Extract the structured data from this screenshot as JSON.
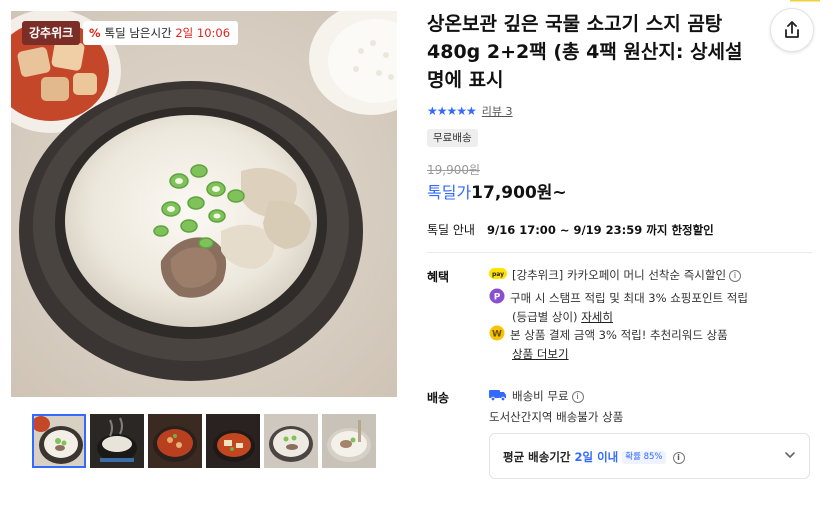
{
  "badges": {
    "brand": "강추위크",
    "deal_icon": "%",
    "deal_label": "톡딜 남은시간",
    "deal_time": "2일 10:06"
  },
  "product": {
    "title": "상온보관 깊은 국물 소고기 스지 곰탕 480g 2+2팩 (총 4팩 원산지: 상세설명에 표시",
    "stars": "★★★★★",
    "rating_stars": 5,
    "review": "리뷰 3",
    "free_shipping": "무료배송",
    "original_price": "19,900원",
    "sale_label": "톡딜가",
    "sale_price": "17,900원~"
  },
  "deal_info": {
    "label": "톡딜 안내",
    "value": "9/16 17:00 ~ 9/19 23:59 까지 한정할인"
  },
  "benefits": {
    "label": "혜택",
    "items": [
      {
        "icon": "kakaopay-icon",
        "text": "[강추위크] 카카오페이 머니 선착순 즉시할인"
      },
      {
        "icon": "point-icon",
        "text": "구매 시 스탬프 적립 및 최대 3% 쇼핑포인트 적립",
        "sub": "(등급별 상이)",
        "link": "자세히"
      },
      {
        "icon": "reward-icon",
        "text": "본 상품 결제 금액 3% 적립! 추천리워드 상품",
        "link": "상품 더보기"
      }
    ]
  },
  "shipping": {
    "label": "배송",
    "fee": "배송비 무료",
    "restriction": "도서산간지역 배송불가 상품",
    "avg_label": "평균 배송기간",
    "avg_value": "2일 이내",
    "probability": "확률 85%"
  },
  "colors": {
    "accent": "#346aff",
    "brand_badge": "#7b2d27",
    "deal_red": "#e2231a"
  },
  "thumbnails": [
    "thumb-gomtang-top",
    "thumb-pot-steam",
    "thumb-spicy-stew",
    "thumb-kimchi-stew",
    "thumb-clear-soup",
    "thumb-beef-soup"
  ]
}
